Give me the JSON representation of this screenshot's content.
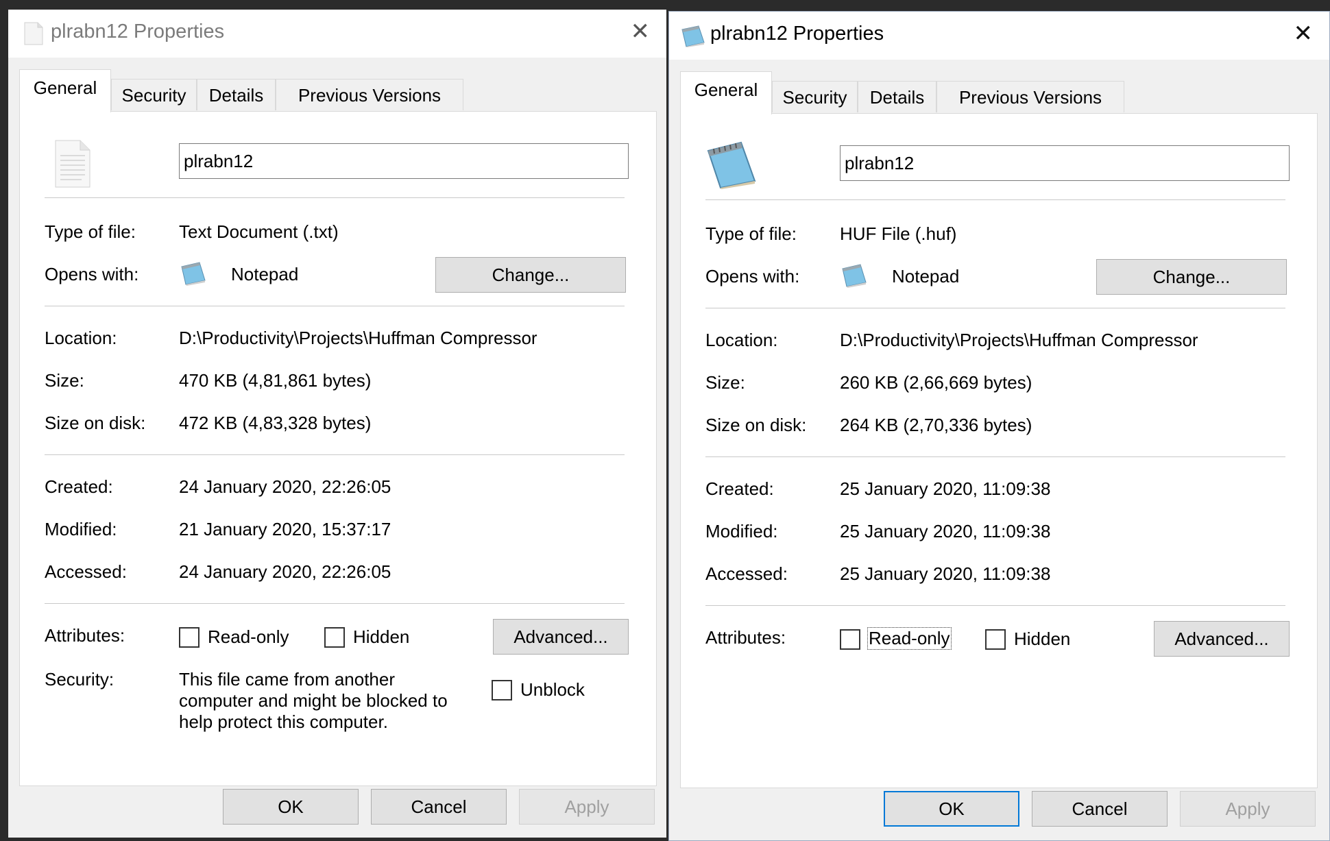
{
  "left": {
    "title": "plrabn12 Properties",
    "tabs": [
      "General",
      "Security",
      "Details",
      "Previous Versions"
    ],
    "filename": "plrabn12",
    "type_label": "Type of file:",
    "type_value": "Text Document (.txt)",
    "opens_label": "Opens with:",
    "opens_value": "Notepad",
    "change_label": "Change...",
    "location_label": "Location:",
    "location_value": "D:\\Productivity\\Projects\\Huffman Compressor",
    "size_label": "Size:",
    "size_value": "470 KB (4,81,861 bytes)",
    "disk_label": "Size on disk:",
    "disk_value": "472 KB (4,83,328 bytes)",
    "created_label": "Created:",
    "created_value": "24 January 2020, 22:26:05",
    "modified_label": "Modified:",
    "modified_value": "21 January 2020, 15:37:17",
    "accessed_label": "Accessed:",
    "accessed_value": "24 January 2020, 22:26:05",
    "attributes_label": "Attributes:",
    "readonly_label": "Read-only",
    "hidden_label": "Hidden",
    "advanced_label": "Advanced...",
    "security_label": "Security:",
    "security_text": "This file came from another computer and might be blocked to help protect this computer.",
    "unblock_label": "Unblock",
    "ok_label": "OK",
    "cancel_label": "Cancel",
    "apply_label": "Apply"
  },
  "right": {
    "title": "plrabn12 Properties",
    "tabs": [
      "General",
      "Security",
      "Details",
      "Previous Versions"
    ],
    "filename": "plrabn12",
    "type_label": "Type of file:",
    "type_value": "HUF File (.huf)",
    "opens_label": "Opens with:",
    "opens_value": "Notepad",
    "change_label": "Change...",
    "location_label": "Location:",
    "location_value": "D:\\Productivity\\Projects\\Huffman Compressor",
    "size_label": "Size:",
    "size_value": "260 KB (2,66,669 bytes)",
    "disk_label": "Size on disk:",
    "disk_value": "264 KB (2,70,336 bytes)",
    "created_label": "Created:",
    "created_value": "25 January 2020, 11:09:38",
    "modified_label": "Modified:",
    "modified_value": "25 January 2020, 11:09:38",
    "accessed_label": "Accessed:",
    "accessed_value": "25 January 2020, 11:09:38",
    "attributes_label": "Attributes:",
    "readonly_label": "Read-only",
    "hidden_label": "Hidden",
    "advanced_label": "Advanced...",
    "ok_label": "OK",
    "cancel_label": "Cancel",
    "apply_label": "Apply"
  },
  "icons": {
    "text_file": "text-file-icon",
    "notepad": "notepad-icon",
    "close": "close-icon"
  },
  "colors": {
    "focus_border": "#0078d7",
    "window_bg": "#f0f0f0",
    "panel_bg": "#ffffff"
  }
}
